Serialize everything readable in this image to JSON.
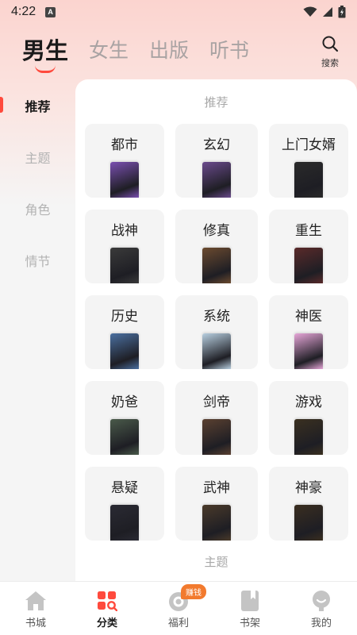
{
  "status_bar": {
    "time": "4:22",
    "notif": "A"
  },
  "top_tabs": [
    {
      "label": "男生",
      "active": true
    },
    {
      "label": "女生",
      "active": false
    },
    {
      "label": "出版",
      "active": false
    },
    {
      "label": "听书",
      "active": false
    }
  ],
  "search": {
    "label": "搜索"
  },
  "side_nav": [
    {
      "label": "推荐",
      "active": true
    },
    {
      "label": "主题",
      "active": false
    },
    {
      "label": "角色",
      "active": false
    },
    {
      "label": "情节",
      "active": false
    }
  ],
  "main": {
    "section_title": "推荐",
    "next_section_title": "主题",
    "categories": [
      {
        "label": "都市",
        "cover_color": "#7a4fb0"
      },
      {
        "label": "玄幻",
        "cover_color": "#6a4a8c"
      },
      {
        "label": "上门女婿",
        "cover_color": "#2a2a2a"
      },
      {
        "label": "战神",
        "cover_color": "#3a3a3a"
      },
      {
        "label": "修真",
        "cover_color": "#6b4a2f"
      },
      {
        "label": "重生",
        "cover_color": "#5a2a2a"
      },
      {
        "label": "历史",
        "cover_color": "#4a6fa0"
      },
      {
        "label": "系统",
        "cover_color": "#b8cfe0"
      },
      {
        "label": "神医",
        "cover_color": "#e6a6d8"
      },
      {
        "label": "奶爸",
        "cover_color": "#4a5a4a"
      },
      {
        "label": "剑帝",
        "cover_color": "#5a4030"
      },
      {
        "label": "游戏",
        "cover_color": "#3a3020"
      },
      {
        "label": "悬疑",
        "cover_color": "#2a2a33"
      },
      {
        "label": "武神",
        "cover_color": "#4a3a2a"
      },
      {
        "label": "神豪",
        "cover_color": "#3a2e20"
      }
    ]
  },
  "bottom_nav": [
    {
      "label": "书城",
      "icon": "home-icon",
      "active": false
    },
    {
      "label": "分类",
      "icon": "category-icon",
      "active": true
    },
    {
      "label": "福利",
      "icon": "welfare-icon",
      "active": false,
      "badge": "赚钱"
    },
    {
      "label": "书架",
      "icon": "bookshelf-icon",
      "active": false
    },
    {
      "label": "我的",
      "icon": "profile-icon",
      "active": false
    }
  ],
  "colors": {
    "accent": "#ff4a3d",
    "badge": "#f27a2e"
  }
}
